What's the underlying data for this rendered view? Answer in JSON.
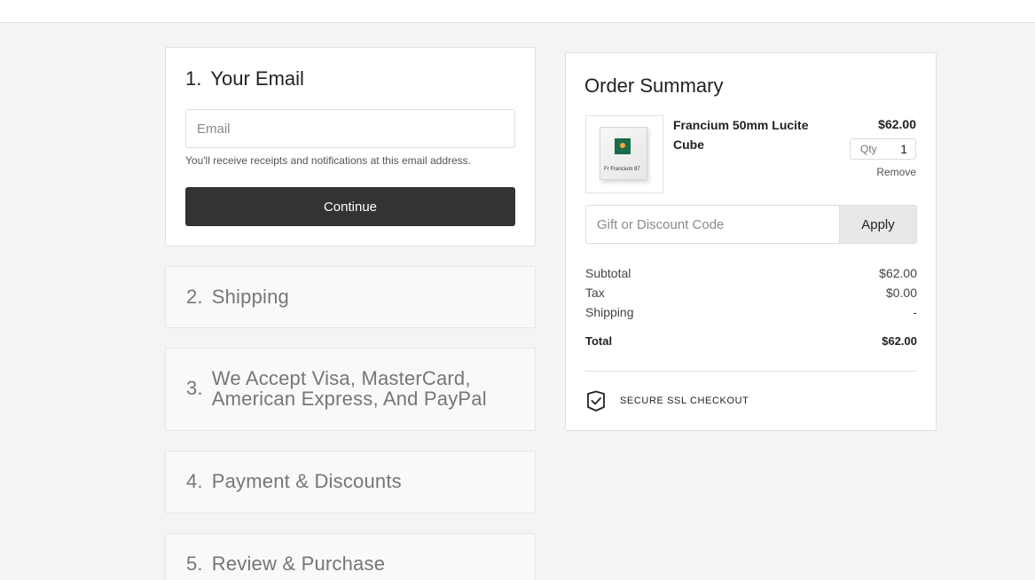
{
  "email_step": {
    "number": "1.",
    "title": "Your Email",
    "placeholder": "Email",
    "hint": "You'll receive receipts and notifications at this email address.",
    "continue_label": "Continue"
  },
  "steps": [
    {
      "number": "2.",
      "title": "Shipping"
    },
    {
      "number": "3.",
      "title": "We Accept Visa, MasterCard, American Express, And PayPal"
    },
    {
      "number": "4.",
      "title": "Payment & Discounts"
    },
    {
      "number": "5.",
      "title": "Review & Purchase"
    }
  ],
  "summary": {
    "title": "Order Summary",
    "item": {
      "name": "Francium 50mm Lucite Cube",
      "price": "$62.00",
      "qty_label": "Qty",
      "qty_value": "1",
      "remove_label": "Remove",
      "image_label": "Fr  Francium  87"
    },
    "discount_placeholder": "Gift or Discount Code",
    "apply_label": "Apply",
    "lines": [
      {
        "label": "Subtotal",
        "value": "$62.00"
      },
      {
        "label": "Tax",
        "value": "$0.00"
      },
      {
        "label": "Shipping",
        "value": "-"
      }
    ],
    "total": {
      "label": "Total",
      "value": "$62.00"
    },
    "secure_label": "SECURE SSL CHECKOUT"
  }
}
